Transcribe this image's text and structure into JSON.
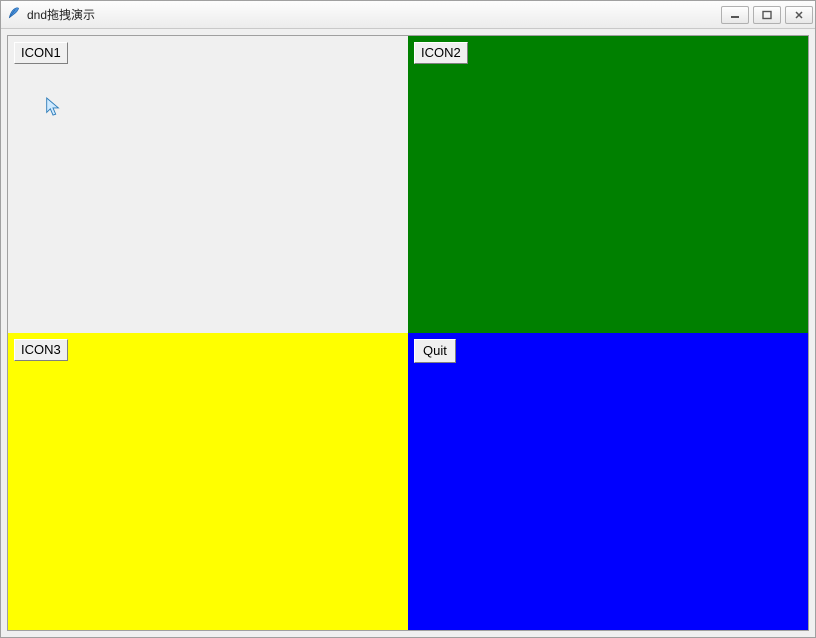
{
  "window": {
    "title": "dnd拖拽演示"
  },
  "panels": {
    "top_left": {
      "label": "ICON1",
      "bg": "#f0f0f0"
    },
    "top_right": {
      "label": "ICON2",
      "bg": "#008000"
    },
    "bottom_left": {
      "label": "ICON3",
      "bg": "#ffff00"
    },
    "bottom_right": {
      "button_label": "Quit",
      "bg": "#0000ff"
    }
  }
}
